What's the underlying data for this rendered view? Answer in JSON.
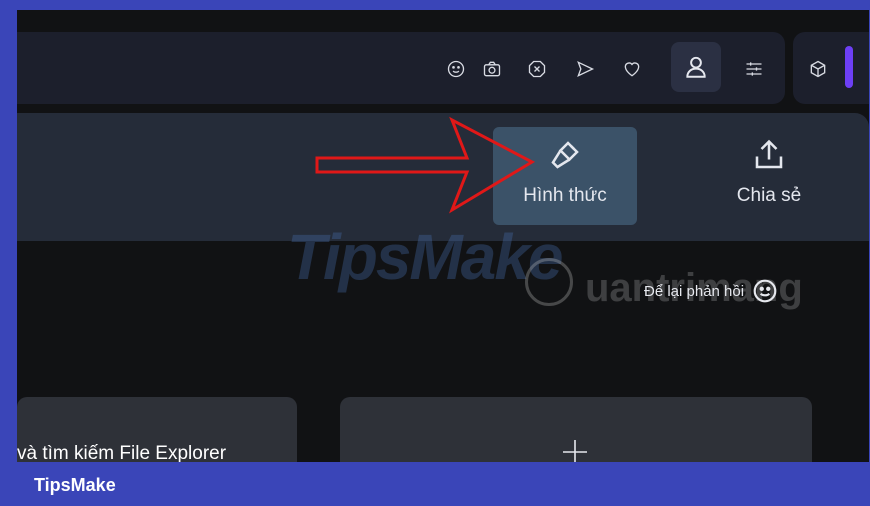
{
  "toolbar": {
    "icons": [
      "smiley-icon",
      "camera-icon",
      "close-hexagon-icon",
      "send-icon",
      "heart-icon",
      "profile-icon",
      "sliders-icon",
      "cube-icon"
    ]
  },
  "ribbon": {
    "appearance_label": "Hình thức",
    "share_label": "Chia sẻ"
  },
  "feedback": {
    "label": "Để lại phản hồi"
  },
  "cards": {
    "card1_text": "và tìm kiếm File Explorer"
  },
  "watermark": {
    "tipsmake": "TipsMake",
    "quantrimang": "uantrimang"
  },
  "banner": {
    "text": "TipsMake"
  },
  "colors": {
    "accent_purple": "#6d3ff5",
    "arrow_red": "#e01818",
    "banner_blue": "#3a45b8"
  }
}
